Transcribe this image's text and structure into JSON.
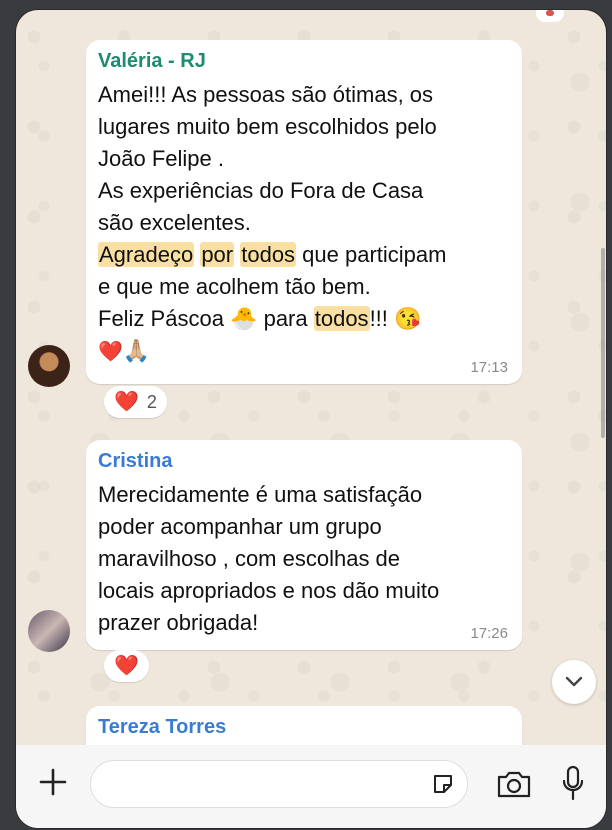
{
  "messages": [
    {
      "sender": "Valéria - RJ",
      "sender_color": "#1f8a70",
      "lines": [
        "Amei!!! As pessoas são ótimas, os",
        "lugares muito bem escolhidos pelo",
        "João Felipe .",
        "As experiências do Fora de Casa",
        "são excelentes."
      ],
      "hl_line": {
        "w1": "Agradeço",
        "w2": "por",
        "w3": "todos",
        "rest": " que participam"
      },
      "line7": "e que me acolhem tão bem.",
      "line8": {
        "pre": "Feliz Páscoa ",
        "chick": "🐣",
        "mid": " para ",
        "hl": "todos",
        "post": "!!! ",
        "kiss": "😘"
      },
      "line9": {
        "heart": "❤️",
        "pray": "🙏🏼"
      },
      "time": "17:13",
      "reaction": {
        "emoji": "❤️",
        "count": "2"
      }
    },
    {
      "sender": "Cristina",
      "sender_color": "#3a7bd5",
      "lines": [
        "Merecidamente é uma satisfação",
        "poder acompanhar um grupo",
        "maravilhoso , com escolhas de",
        "locais apropriados e nos dão muito",
        "prazer obrigada!"
      ],
      "time": "17:26",
      "reaction": {
        "emoji": "❤️"
      }
    },
    {
      "sender": "Tereza Torres",
      "sender_color": "#3a7bd5"
    }
  ],
  "composer": {
    "placeholder": ""
  },
  "icons": [
    "plus-icon",
    "sticker-icon",
    "camera-icon",
    "microphone-icon",
    "chevron-down-icon"
  ]
}
